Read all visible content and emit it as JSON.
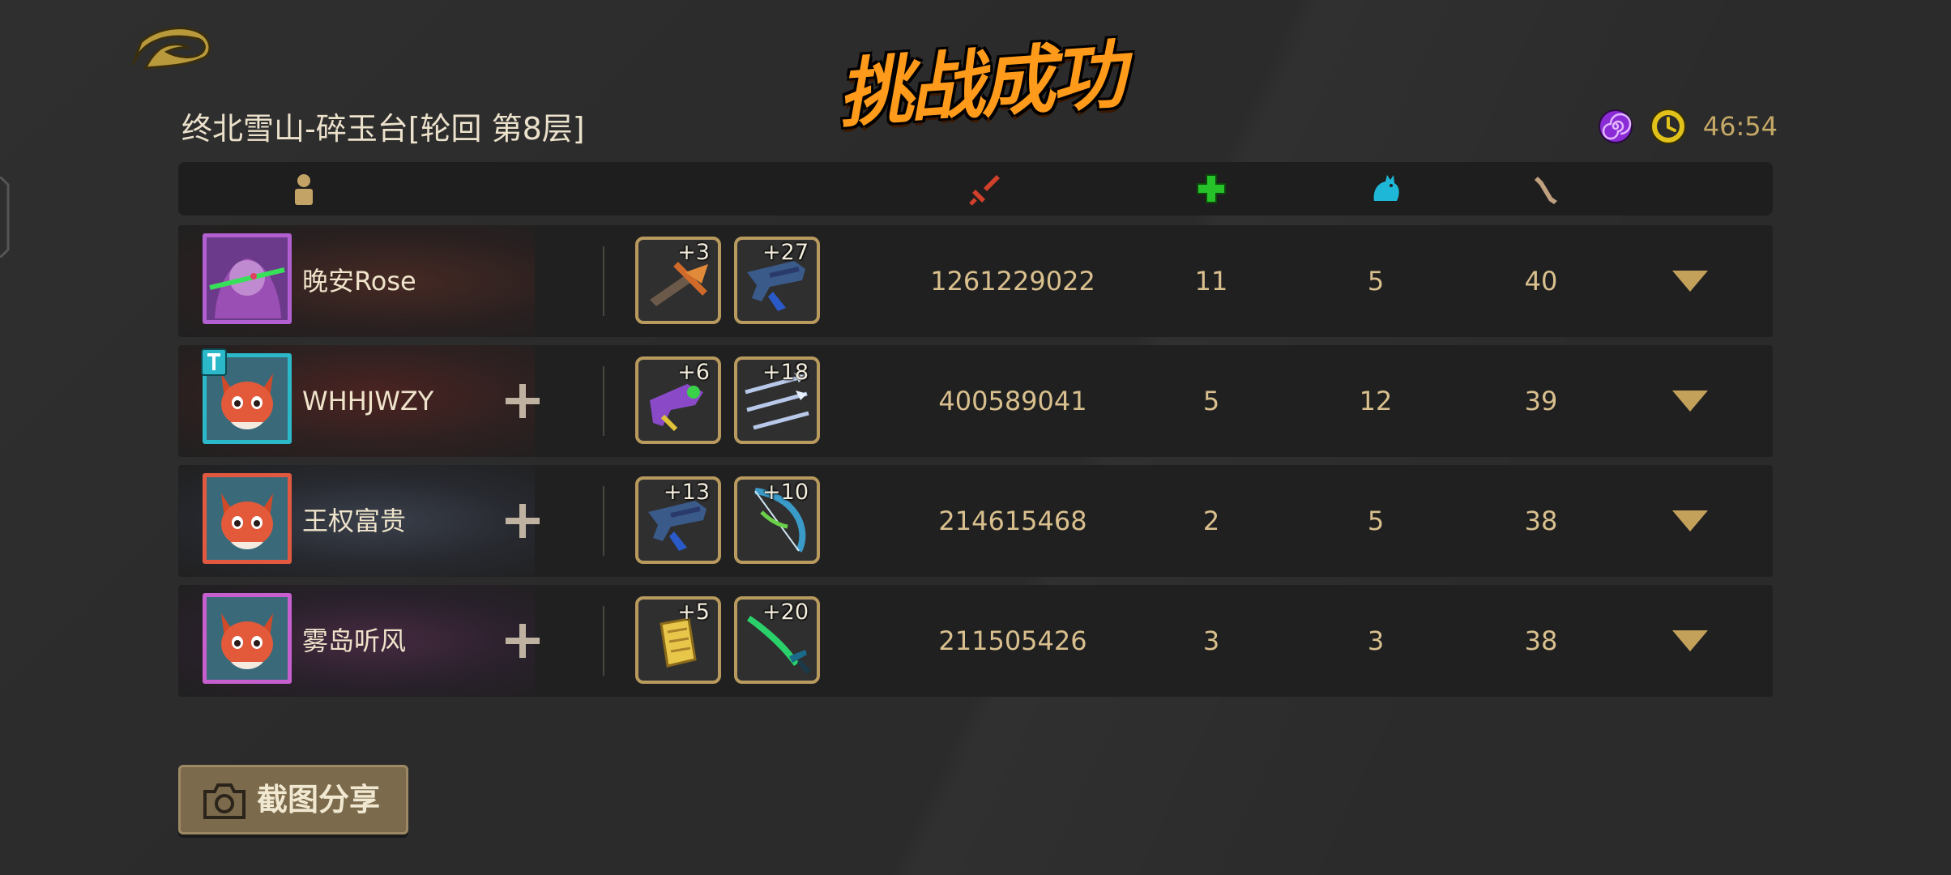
{
  "title": "挑战成功",
  "level_name": "终北雪山-碎玉台[轮回  第8层]",
  "status": {
    "timer": "46:54",
    "colors": {
      "spiral": "#8a2bd6",
      "clock": "#e1c21a"
    }
  },
  "header_icons": [
    "player-icon",
    "damage-icon",
    "heal-icon",
    "pet-icon",
    "bone-icon"
  ],
  "players": [
    {
      "name": "晚安Rose",
      "frame_color": "#b25fd1",
      "has_add": false,
      "has_team_badge": false,
      "weapons": [
        {
          "level": "+3",
          "icon": "crossbow-icon"
        },
        {
          "level": "+27",
          "icon": "blaster-icon"
        }
      ],
      "damage": "1261229022",
      "heal": "11",
      "pet": "5",
      "bone": "40"
    },
    {
      "name": "WHHJWZY",
      "frame_color": "#2bb9c9",
      "has_add": true,
      "has_team_badge": true,
      "team_badge": "T",
      "weapons": [
        {
          "level": "+6",
          "icon": "ray-gun-icon"
        },
        {
          "level": "+18",
          "icon": "triple-spear-icon"
        }
      ],
      "damage": "400589041",
      "heal": "5",
      "pet": "12",
      "bone": "39"
    },
    {
      "name": "王权富贵",
      "frame_color": "#e2593f",
      "has_add": true,
      "has_team_badge": false,
      "weapons": [
        {
          "level": "+13",
          "icon": "blaster-icon"
        },
        {
          "level": "+10",
          "icon": "bow-icon"
        }
      ],
      "damage": "214615468",
      "heal": "2",
      "pet": "5",
      "bone": "38"
    },
    {
      "name": "雾岛听风",
      "frame_color": "#c85fcf",
      "has_add": true,
      "has_team_badge": false,
      "weapons": [
        {
          "level": "+5",
          "icon": "scroll-icon"
        },
        {
          "level": "+20",
          "icon": "green-sword-icon"
        }
      ],
      "damage": "211505426",
      "heal": "3",
      "pet": "3",
      "bone": "38"
    }
  ],
  "share_button": {
    "label": "截图分享",
    "icon": "camera-icon"
  }
}
